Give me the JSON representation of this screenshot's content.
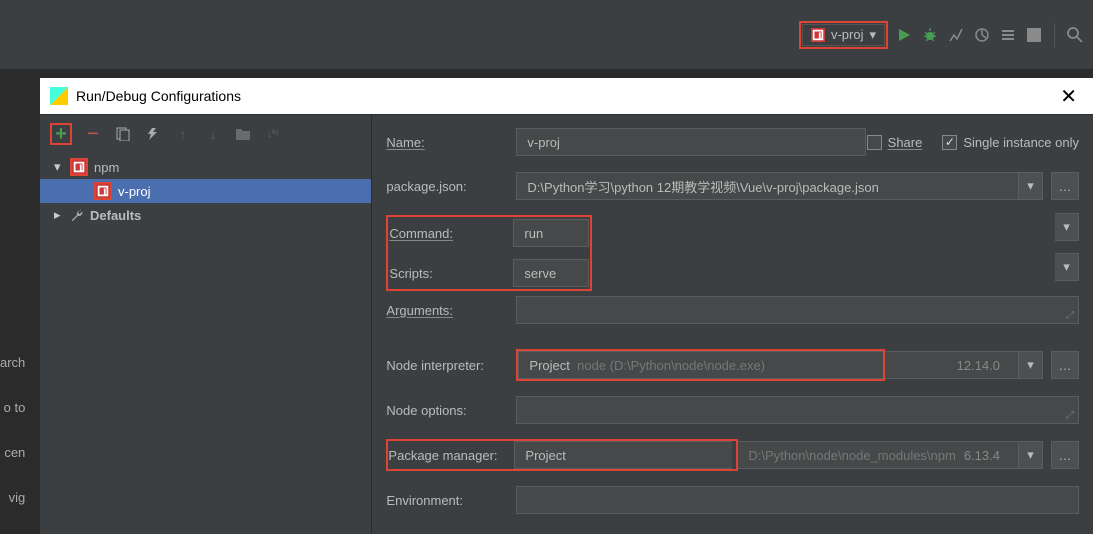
{
  "ide": {
    "run_config_selected": "v-proj",
    "bg_lines": [
      "arch",
      "o to",
      "cen",
      "vig"
    ]
  },
  "dialog": {
    "title": "Run/Debug Configurations",
    "tree": {
      "npm_label": "npm",
      "vproj_label": "v-proj",
      "defaults_label": "Defaults"
    },
    "name_label": "Name:",
    "name_value": "v-proj",
    "share_label": "Share",
    "single_instance_label": "Single instance only",
    "single_instance_checked": true,
    "package_json_label": "package.json:",
    "package_json_value": "D:\\Python学习\\python 12期教学视频\\Vue\\v-proj\\package.json",
    "command_label": "Command:",
    "command_value": "run",
    "scripts_label": "Scripts:",
    "scripts_value": "serve",
    "arguments_label": "Arguments:",
    "arguments_value": "",
    "node_interp_label": "Node interpreter:",
    "node_interp_prefix": "Project",
    "node_interp_path": "node (D:\\Python\\node\\node.exe)",
    "node_interp_version": "12.14.0",
    "node_options_label": "Node options:",
    "node_options_value": "",
    "pkg_manager_label": "Package manager:",
    "pkg_manager_prefix": "Project",
    "pkg_manager_path": "D:\\Python\\node\\node_modules\\npm",
    "pkg_manager_version": "6.13.4",
    "env_label": "Environment:",
    "env_value": ""
  }
}
